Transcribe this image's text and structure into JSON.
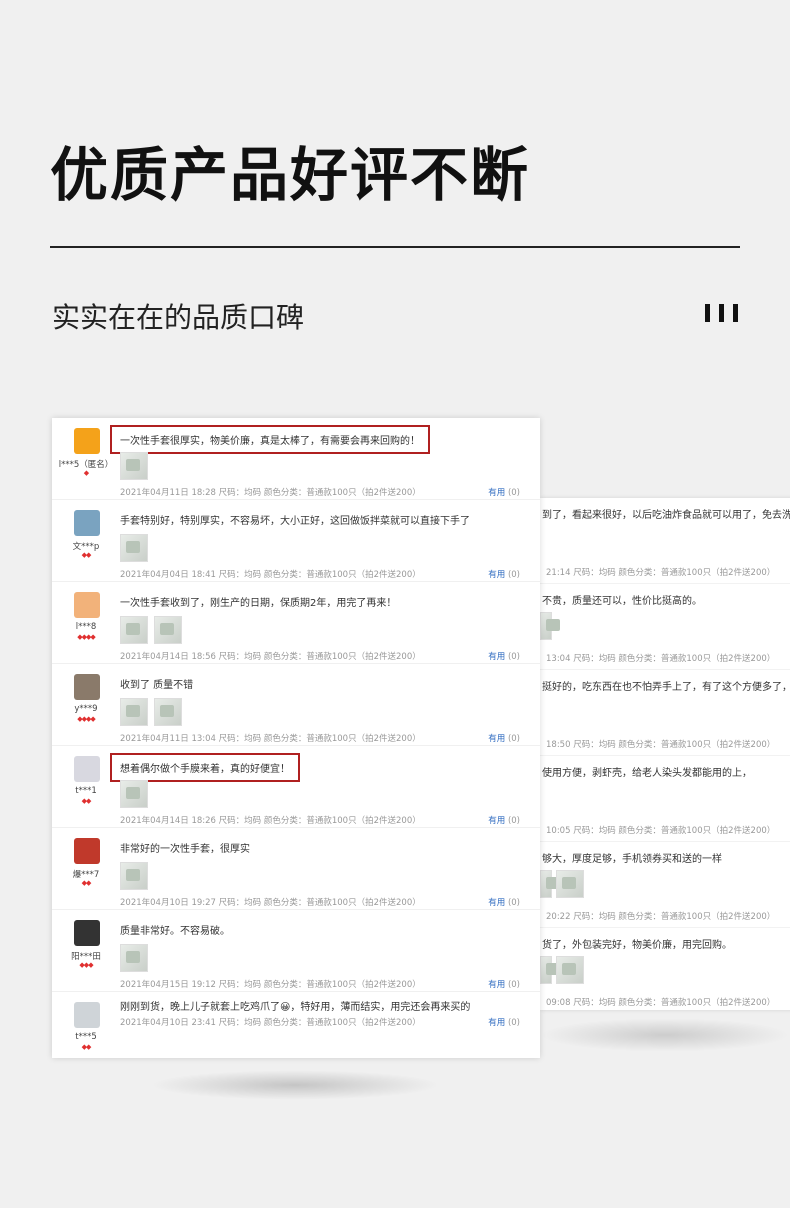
{
  "header": {
    "title": "优质产品好评不断",
    "subtitle": "实实在在的品质口碑"
  },
  "colors": {
    "highlight_box": "#b02020",
    "useful_link": "#2f6bc0"
  },
  "reviews": [
    {
      "user": "l***5（匿名）",
      "level": "◆",
      "text": "一次性手套很厚实，物美价廉，真是太棒了，有需要会再来回购的！",
      "boxed": true,
      "meta": "2021年04月11日 18:28    尺码：均码    颜色分类：普通款100只（拍2件送200）",
      "useful": "有用",
      "useful_count": "(0)",
      "thumbs": 1,
      "avatar_color": "#f4a21a"
    },
    {
      "user": "文***p",
      "level": "◆◆",
      "text": "手套特别好，特别厚实，不容易坏，大小正好，这回做饭拌菜就可以直接下手了",
      "boxed": false,
      "meta": "2021年04月04日 18:41    尺码：均码    颜色分类：普通款100只（拍2件送200）",
      "useful": "有用",
      "useful_count": "(0)",
      "thumbs": 1,
      "avatar_color": "#7aa3c0"
    },
    {
      "user": "l***8",
      "level": "◆◆◆◆",
      "text": "一次性手套收到了，刚生产的日期，保质期2年，用完了再来！",
      "boxed": false,
      "meta": "2021年04月14日 18:56    尺码：均码    颜色分类：普通款100只（拍2件送200）",
      "useful": "有用",
      "useful_count": "(0)",
      "thumbs": 2,
      "avatar_color": "#f2b27a"
    },
    {
      "user": "y***9",
      "level": "◆◆◆◆",
      "text": "收到了 质量不错",
      "boxed": false,
      "meta": "2021年04月11日 13:04    尺码：均码    颜色分类：普通款100只（拍2件送200）",
      "useful": "有用",
      "useful_count": "(0)",
      "thumbs": 2,
      "avatar_color": "#8a7a6a"
    },
    {
      "user": "t***1",
      "level": "◆◆",
      "text": "想着偶尔做个手膜来着，真的好便宜！",
      "boxed": true,
      "meta": "2021年04月14日 18:26    尺码：均码    颜色分类：普通款100只（拍2件送200）",
      "useful": "有用",
      "useful_count": "(0)",
      "thumbs": 1,
      "avatar_color": "#d8d8e0"
    },
    {
      "user": "爆***7",
      "level": "◆◆",
      "text": "非常好的一次性手套，很厚实",
      "boxed": false,
      "meta": "2021年04月10日 19:27    尺码：均码    颜色分类：普通款100只（拍2件送200）",
      "useful": "有用",
      "useful_count": "(0)",
      "thumbs": 1,
      "avatar_color": "#c0392b"
    },
    {
      "user": "阳***田",
      "level": "◆◆◆",
      "text": "质量非常好。不容易破。",
      "boxed": false,
      "meta": "2021年04月15日 19:12    尺码：均码    颜色分类：普通款100只（拍2件送200）",
      "useful": "有用",
      "useful_count": "(0)",
      "thumbs": 1,
      "avatar_color": "#333333"
    },
    {
      "user": "t***5",
      "level": "◆◆",
      "text": "刚刚到货，晚上儿子就套上吃鸡爪了😀，特好用，薄而结实，用完还会再来买的",
      "boxed": false,
      "meta": "2021年04月10日 23:41    尺码：均码    颜色分类：普通款100只（拍2件送200）",
      "useful": "有用",
      "useful_count": "(0)",
      "thumbs": 0,
      "avatar_color": "#cfd4d8"
    }
  ],
  "back_reviews": [
    {
      "text": "到了，看起来很好，以后吃油炸食品就可以用了，免去洗手。",
      "meta": "21:14    尺码：均码    颜色分类：普通款100只（拍2件送200）",
      "thumbs": 0
    },
    {
      "text": "不贵，质量还可以，性价比挺高的。",
      "meta": "13:04    尺码：均码    颜色分类：普通款100只（拍2件送200）",
      "thumbs": 1
    },
    {
      "text": "挺好的，吃东西在也不怕弄手上了，有了这个方便多了，值得",
      "meta": "18:50    尺码：均码    颜色分类：普通款100只（拍2件送200）",
      "thumbs": 0
    },
    {
      "text": "使用方便，剥虾壳，给老人染头发都能用的上，",
      "meta": "10:05    尺码：均码    颜色分类：普通款100只（拍2件送200）",
      "thumbs": 0
    },
    {
      "text": "够大，厚度足够，手机领券买和送的一样",
      "meta": "20:22    尺码：均码    颜色分类：普通款100只（拍2件送200）",
      "thumbs": 2
    },
    {
      "text": "货了，外包装完好，物美价廉，用完回购。",
      "meta": "09:08    尺码：均码    颜色分类：普通款100只（拍2件送200）",
      "thumbs": 2
    }
  ]
}
